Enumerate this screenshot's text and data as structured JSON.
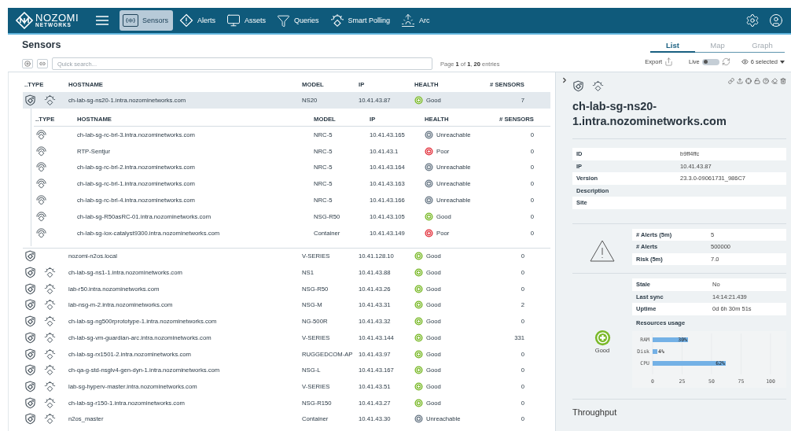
{
  "navbar": {
    "logo": {
      "line1": "NOZOMI",
      "line2": "NETWORKS"
    },
    "items": [
      {
        "label": "Sensors",
        "selected": true
      },
      {
        "label": "Alerts",
        "selected": false
      },
      {
        "label": "Assets",
        "selected": false
      },
      {
        "label": "Queries",
        "selected": false
      },
      {
        "label": "Smart Polling",
        "selected": false
      },
      {
        "label": "Arc",
        "selected": false
      }
    ]
  },
  "page": {
    "title": "Sensors",
    "search": {
      "placeholder": "Quick search..."
    },
    "pagination": "Page **1** of **1**, **20** entries",
    "view_tabs": [
      {
        "label": "List",
        "selected": true
      },
      {
        "label": "Map",
        "selected": false
      },
      {
        "label": "Graph",
        "selected": false
      }
    ],
    "export": "Export",
    "live": {
      "label": "Live",
      "on": false
    },
    "columns_selector": "6 selected"
  },
  "table": {
    "columns": [
      "..TYPE",
      "HOSTNAME",
      "MODEL",
      "IP",
      "HEALTH",
      "# SENSORS"
    ],
    "rows": [
      {
        "kind": "guardian_arc",
        "hostname": "ch-lab-sg-ns20-1.intra.nozominetworks.com",
        "model": "NS20",
        "ip": "10.41.43.87",
        "health": "Good",
        "color": "#7ab929",
        "sensors": "7",
        "selected": true,
        "expanded": true,
        "children": {
          "columns": [
            "..TYPE",
            "HOSTNAME",
            "MODEL",
            "IP",
            "HEALTH",
            "# SENSORS"
          ],
          "rows": [
            {
              "kind": "remote_collector",
              "hostname": "ch-lab-sg-rc-brl-3.intra.nozominetworks.com",
              "model": "NRC-5",
              "ip": "10.41.43.165",
              "health": "Unreachable",
              "color": "#6b7a88",
              "sensors": "0"
            },
            {
              "kind": "remote_collector",
              "hostname": "RTP-Sentjur",
              "model": "NRC-5",
              "ip": "10.41.43.1",
              "health": "Poor",
              "color": "#e3343f",
              "sensors": "0"
            },
            {
              "kind": "remote_collector",
              "hostname": "ch-lab-sg-rc-brl-2.intra.nozominetworks.com",
              "model": "NRC-5",
              "ip": "10.41.43.164",
              "health": "Unreachable",
              "color": "#6b7a88",
              "sensors": "0"
            },
            {
              "kind": "remote_collector",
              "hostname": "ch-lab-sg-rc-brl-1.intra.nozominetworks.com",
              "model": "NRC-5",
              "ip": "10.41.43.163",
              "health": "Unreachable",
              "color": "#6b7a88",
              "sensors": "0"
            },
            {
              "kind": "remote_collector",
              "hostname": "ch-lab-sg-rc-brl-4.intra.nozominetworks.com",
              "model": "NRC-5",
              "ip": "10.41.43.166",
              "health": "Unreachable",
              "color": "#6b7a88",
              "sensors": "0"
            },
            {
              "kind": "remote_collector",
              "hostname": "ch-lab-sg-R50asRC-01.intra.nozominetworks.com",
              "model": "NSG-R50",
              "ip": "10.41.43.105",
              "health": "Good",
              "color": "#7ab929",
              "sensors": "0"
            },
            {
              "kind": "remote_collector",
              "hostname": "ch-lab-sg-iox-catalyst9300.intra.nozominetworks.com",
              "model": "Container",
              "ip": "10.41.43.149",
              "health": "Poor",
              "color": "#e3343f",
              "sensors": "0"
            }
          ]
        }
      },
      {
        "kind": "guardian",
        "hostname": "nozomi-n2os.local",
        "model": "V-SERIES",
        "ip": "10.41.128.10",
        "health": "Good",
        "color": "#7ab929",
        "sensors": "0",
        "selected": false
      },
      {
        "kind": "guardian_arc",
        "hostname": "ch-lab-sg-ns1-1.intra.nozominetworks.com",
        "model": "NS1",
        "ip": "10.41.43.88",
        "health": "Good",
        "color": "#7ab929",
        "sensors": "0",
        "selected": false
      },
      {
        "kind": "guardian_arc",
        "hostname": "lab-r50.intra.nozominetworks.com",
        "model": "NSG-R50",
        "ip": "10.41.43.26",
        "health": "Good",
        "color": "#7ab929",
        "sensors": "0",
        "selected": false
      },
      {
        "kind": "guardian_arc",
        "hostname": "lab-nsg-m-2.intra.nozominetworks.com",
        "model": "NSG-M",
        "ip": "10.41.43.31",
        "health": "Good",
        "color": "#7ab929",
        "sensors": "2",
        "selected": false
      },
      {
        "kind": "guardian_arc",
        "hostname": "ch-lab-sg-ng500rprototype-1.intra.nozominetworks.com",
        "model": "NG-500R",
        "ip": "10.41.43.32",
        "health": "Good",
        "color": "#7ab929",
        "sensors": "0",
        "selected": false
      },
      {
        "kind": "guardian_arc",
        "hostname": "ch-lab-sg-vm-guardian-arc.intra.nozominetworks.com",
        "model": "V-SERIES",
        "ip": "10.41.43.144",
        "health": "Good",
        "color": "#7ab929",
        "sensors": "331",
        "selected": false
      },
      {
        "kind": "guardian_arc",
        "hostname": "ch-lab-sg-rx1501-2.intra.nozominetworks.com",
        "model": "RUGGEDCOM-AP",
        "ip": "10.41.43.97",
        "health": "Good",
        "color": "#7ab929",
        "sensors": "0",
        "selected": false
      },
      {
        "kind": "guardian_arc",
        "hostname": "ch-qa-g-std-nsglv4-gen-dyn-1.intra.nozominetworks.com",
        "model": "NSG-L",
        "ip": "10.41.43.167",
        "health": "Good",
        "color": "#7ab929",
        "sensors": "0",
        "selected": false
      },
      {
        "kind": "guardian_arc",
        "hostname": "lab-sg-hyperv-master.intra.nozominetworks.com",
        "model": "V-SERIES",
        "ip": "10.41.43.51",
        "health": "Good",
        "color": "#7ab929",
        "sensors": "0",
        "selected": false
      },
      {
        "kind": "guardian_arc",
        "hostname": "ch-lab-sg-r150-1.intra.nozominetworks.com",
        "model": "NSG-R150",
        "ip": "10.41.43.27",
        "health": "Good",
        "color": "#7ab929",
        "sensors": "0",
        "selected": false
      },
      {
        "kind": "guardian_arc",
        "hostname": "n2os_master",
        "model": "Container",
        "ip": "10.41.43.30",
        "health": "Unreachable",
        "color": "#6b7a88",
        "sensors": "0",
        "selected": false
      }
    ]
  },
  "details": {
    "kind": "guardian_arc",
    "title": "ch-lab-sg-ns20-1.intra.nozominetworks.com",
    "info": [
      {
        "label": "ID",
        "value": "b9ff4ffc"
      },
      {
        "label": "IP",
        "value": "10.41.43.87"
      },
      {
        "label": "Version",
        "value": "23.3.0-09061731_986C7"
      },
      {
        "label": "Description"
      },
      {
        "label": "Site"
      }
    ],
    "alerts": [
      {
        "label": "# Alerts (5m)",
        "value": "5"
      },
      {
        "label": "# Alerts",
        "value": "500000"
      },
      {
        "label": "Risk (5m)",
        "value": "7.0"
      }
    ],
    "health": {
      "label": "Good",
      "color": "#7ab929"
    },
    "status": [
      {
        "label": "Stale",
        "value": "No"
      },
      {
        "label": "Last sync",
        "value": "14:14:21.439"
      },
      {
        "label": "Uptime",
        "value": "0d 6h 30m 51s"
      }
    ],
    "resources_title": "Resources usage",
    "chart_data": {
      "type": "bar",
      "orientation": "horizontal",
      "categories": [
        "RAM",
        "Disk",
        "CPU"
      ],
      "values": [
        30,
        4,
        62
      ],
      "xlim": [
        0,
        100
      ],
      "xticks": [
        0,
        25,
        50,
        75,
        100
      ],
      "value_labels": [
        "30%",
        "4%",
        "62%"
      ]
    },
    "throughput_title": "Throughput"
  }
}
